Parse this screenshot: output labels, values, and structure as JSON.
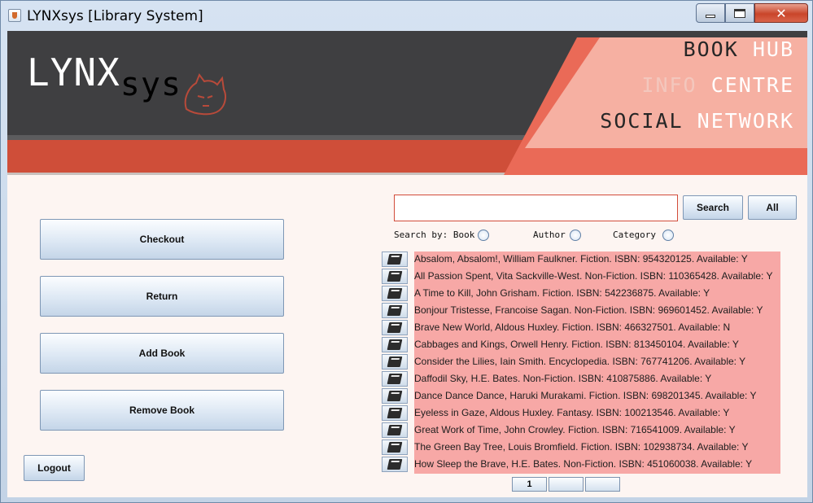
{
  "window": {
    "title": "LYNXsys [Library System]",
    "controls": {
      "minimize": "minimize",
      "maximize": "maximize",
      "close": "✕"
    }
  },
  "header": {
    "logo_main": "LYNX",
    "logo_sub": "sys",
    "nav": [
      {
        "word1": "BOOK",
        "word2": "HUB"
      },
      {
        "word1": "INFO",
        "word2": "CENTRE"
      },
      {
        "word1": "SOCIAL",
        "word2": "NETWORK"
      }
    ]
  },
  "actions": {
    "checkout": "Checkout",
    "return": "Return",
    "add_book": "Add Book",
    "remove_book": "Remove Book",
    "logout": "Logout"
  },
  "search": {
    "value": "",
    "placeholder": "",
    "search_button": "Search",
    "all_button": "All",
    "search_by_label": "Search by: Book",
    "author_label": "Author",
    "category_label": "Category"
  },
  "books": [
    "Absalom, Absalom!, William Faulkner. Fiction. ISBN: 954320125. Available: Y",
    "All Passion Spent, Vita Sackville-West. Non-Fiction. ISBN: 110365428. Available: Y",
    "A Time to Kill, John Grisham. Fiction. ISBN: 542236875. Available: Y",
    "Bonjour Tristesse, Francoise Sagan. Non-Fiction. ISBN: 969601452. Available: Y",
    "Brave New World, Aldous Huxley. Fiction. ISBN: 466327501. Available: N",
    "Cabbages and Kings, Orwell Henry. Fiction. ISBN: 813450104. Available: Y",
    "Consider the Lilies, Iain Smith. Encyclopedia. ISBN: 767741206. Available: Y",
    "Daffodil Sky, H.E. Bates. Non-Fiction. ISBN: 410875886. Available: Y",
    "Dance Dance Dance, Haruki Murakami. Fiction. ISBN: 698201345. Available: Y",
    "Eyeless in Gaze, Aldous Huxley. Fantasy. ISBN: 100213546. Available: Y",
    "Great Work of Time, John Crowley. Fiction. ISBN: 716541009. Available: Y",
    "The Green Bay Tree, Louis Bromfield. Fiction. ISBN: 102938734. Available: Y",
    "How Sleep the Brave, H.E. Bates. Non-Fiction. ISBN: 451060038. Available: Y"
  ],
  "pagination": [
    "1",
    "",
    ""
  ],
  "colors": {
    "banner_dark": "#3f3f41",
    "banner_red": "#cf4e39",
    "banner_pink": "#f6b0a2",
    "row_highlight": "#f7a8a6"
  }
}
